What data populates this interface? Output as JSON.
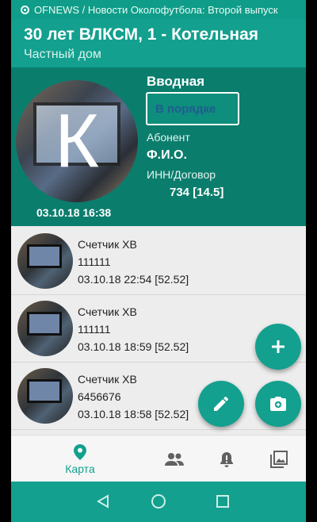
{
  "status_bar": {
    "notification": "OFNEWS / Новости Околофутбола: Второй выпуск"
  },
  "app_bar": {
    "title": "30 лет ВЛКСМ, 1 - Котельная",
    "subtitle": "Частный дом"
  },
  "intro": {
    "avatar_letter": "К",
    "date": "03.10.18 16:38",
    "heading": "Вводная",
    "status_button": "В порядке",
    "subscriber_label": "Абонент",
    "subscriber_value": "Ф.И.О.",
    "contract_label": "ИНН/Договор",
    "contract_value": "734 [14.5]"
  },
  "readings": [
    {
      "name": "Счетчик ХВ",
      "number": "111111",
      "when": "03.10.18 22:54 [52.52]"
    },
    {
      "name": "Счетчик ХВ",
      "number": "111111",
      "when": "03.10.18 18:59 [52.52]"
    },
    {
      "name": "Счетчик ХВ",
      "number": "6456676",
      "when": "03.10.18 18:58 [52.52]"
    }
  ],
  "bottom_nav": {
    "items": [
      {
        "label": "Карта",
        "icon": "map-pin-icon",
        "active": true
      },
      {
        "label": "",
        "icon": "people-icon"
      },
      {
        "label": "",
        "icon": "alert-bell-icon"
      },
      {
        "label": "",
        "icon": "gallery-icon"
      }
    ]
  },
  "colors": {
    "primary": "#13a08e",
    "primary_dark": "#0b7d6d",
    "status_text": "#1e5e8f"
  }
}
